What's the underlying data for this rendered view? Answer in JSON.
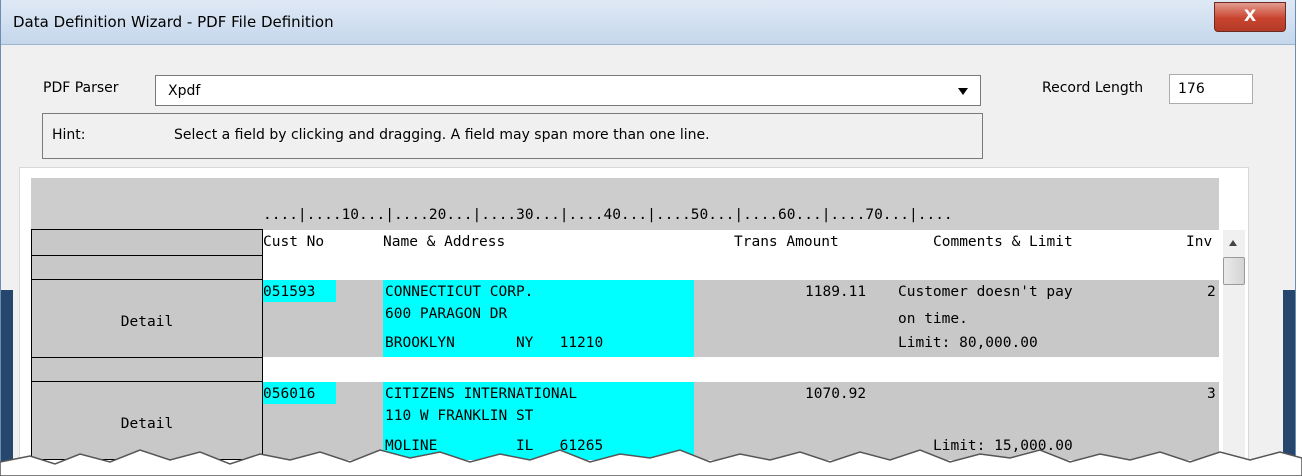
{
  "window": {
    "title": "Data Definition Wizard - PDF File Definition",
    "close_glyph": "X"
  },
  "parser": {
    "label": "PDF Parser",
    "value": "Xpdf"
  },
  "record_length": {
    "label": "Record Length",
    "value": "176"
  },
  "hint": {
    "label": "Hint:",
    "text": "Select a field by clicking and dragging. A field may span more than one line."
  },
  "grid": {
    "ruler": "....|....10...|....20...|....30...|....40...|....50...|....60...|....70...|....",
    "columns": {
      "cust_no": "Cust No",
      "name_address": "Name & Address",
      "trans_amount": "Trans Amount",
      "comments_limit": "Comments & Limit",
      "inv": "Inv"
    },
    "records": [
      {
        "row_label": "Detail",
        "cust_no": "051593",
        "name_lines": [
          "CONNECTICUT CORP.",
          "600 PARAGON DR",
          "BROOKLYN       NY   11210"
        ],
        "amount": "1189.11",
        "comment_lines": [
          "Customer doesn't pay",
          "on time.",
          "Limit: 80,000.00"
        ],
        "inv": "2"
      },
      {
        "row_label": "Detail",
        "cust_no": "056016",
        "name_lines": [
          "CITIZENS INTERNATIONAL",
          "110 W FRANKLIN ST",
          "MOLINE         IL   61265"
        ],
        "amount": "1070.92",
        "comment_lines": [
          "",
          "",
          "Limit: 15,000.00"
        ],
        "inv": "3"
      }
    ]
  },
  "colors": {
    "field_highlight": "#00ffff",
    "row_gray": "#c8c8c8",
    "close_red": "#c9442f"
  }
}
